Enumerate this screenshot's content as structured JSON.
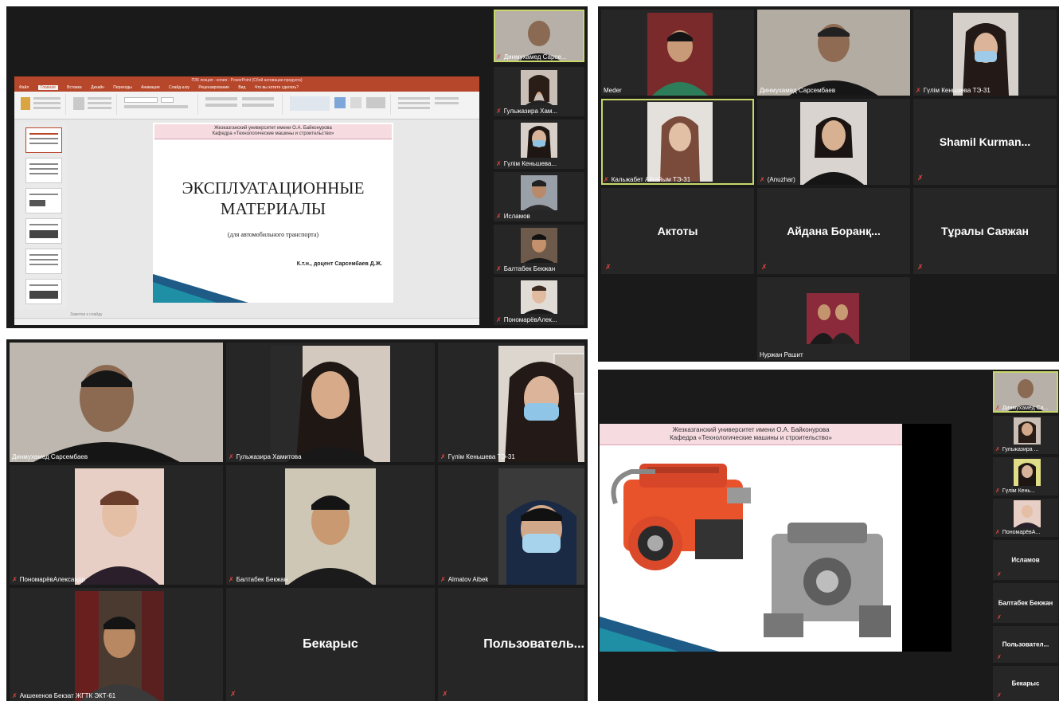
{
  "q1": {
    "ppt": {
      "title": "ПЗ6 лекция - копия - PowerPoint (Сбой активации продукта)",
      "tabs": [
        "Файл",
        "Главная",
        "Вставка",
        "Дизайн",
        "Переходы",
        "Анимация",
        "Слайд-шоу",
        "Рецензирование",
        "Вид",
        "Что вы хотите сделать?"
      ],
      "slide": {
        "univ": "Жезказганский университет имени О.А. Байконурова",
        "dept": "Кафедра «Технологические машины и строительство»",
        "title1": "ЭКСПЛУАТАЦИОННЫЕ",
        "title2": "МАТЕРИАЛЫ",
        "subtitle": "(для автомобильного транспорта)",
        "author": "К.т.н., доцент Сарсембаев Д.Ж."
      },
      "notes": "Заметки к слайду"
    },
    "sidebar": [
      "Динмухамед Сарсе...",
      "Гульжазира Хам...",
      "Гүлім Кеньшева...",
      "Исламов",
      "Балтабек Бекжан",
      "ПономарёвАлек..."
    ]
  },
  "q2": {
    "tiles": [
      {
        "name": "Meder"
      },
      {
        "name": "Динмухамед Сарсембаев"
      },
      {
        "name": "Гүлім Кеньшева ТЭ-31"
      },
      {
        "name": "Кальжабет Айгайым ТЭ-31"
      },
      {
        "name": "(Anuzhar)"
      },
      {
        "big": "Shamil  Kurman..."
      },
      {
        "big": "Актоты"
      },
      {
        "big": "Айдана  Боранқ..."
      },
      {
        "big": "Тұралы Саяжан"
      },
      {
        "name": "Нуржан Рашит"
      }
    ]
  },
  "q3": {
    "tiles": [
      {
        "name": "Динмухамед Сарсембаев"
      },
      {
        "name": "Гульжазира Хамитова"
      },
      {
        "name": "Гүлім Кеньшева ТЭ-31"
      },
      {
        "name": "ПономарёвАлександр"
      },
      {
        "name": "Балтабек Бекжан"
      },
      {
        "name": "Almatov Aibek"
      },
      {
        "name": "Акшекенов Бекзат ЖГТК ЭКТ-61"
      },
      {
        "big": "Бекарыс"
      },
      {
        "big": "Пользователь..."
      }
    ]
  },
  "q4": {
    "slide": {
      "univ": "Жезказганский университет имени О.А. Байконурова",
      "dept": "Кафедра «Технологические машины и строительство»"
    },
    "sidebar": [
      {
        "name": "Динмухамед Са..."
      },
      {
        "name": "Гульжазира ..."
      },
      {
        "name": "Гүлім Кень..."
      },
      {
        "name": "ПономарёвА..."
      },
      {
        "big": "Исламов"
      },
      {
        "big": "Балтабек Бекжан"
      },
      {
        "big": "Пользовател..."
      },
      {
        "big": "Бекарыс"
      }
    ]
  },
  "colors": {
    "active_border": "#c8d66a",
    "mic_muted": "#e0473e",
    "ppt_brand": "#b7472a"
  }
}
